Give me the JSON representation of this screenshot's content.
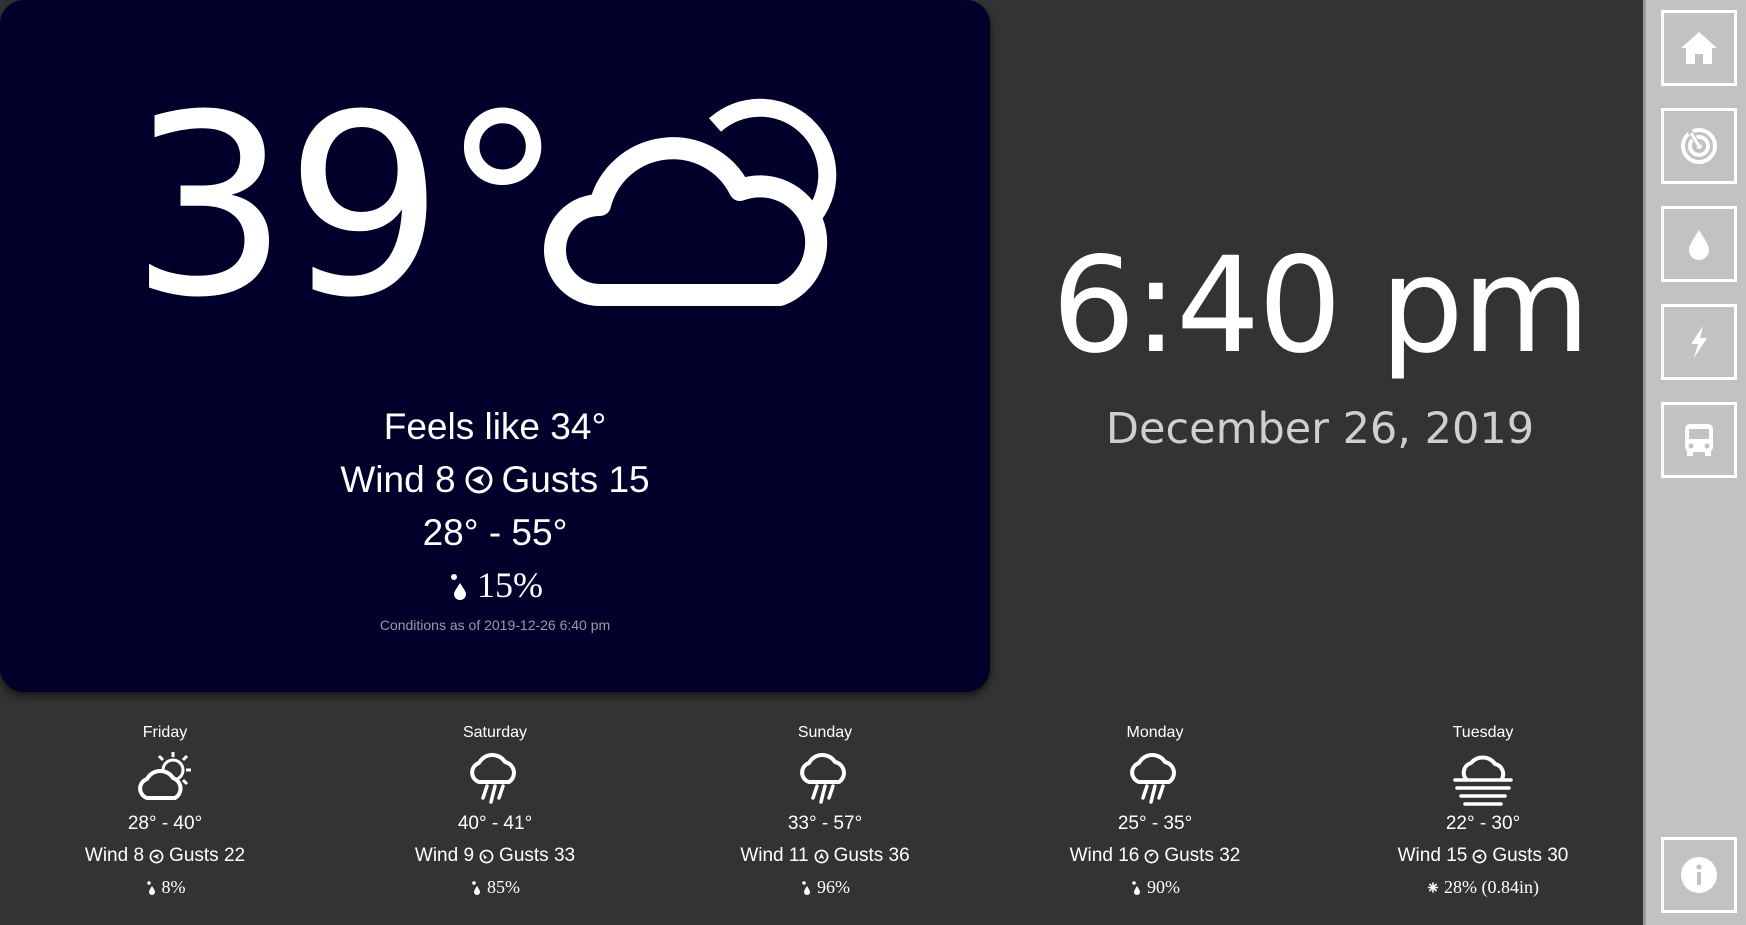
{
  "current": {
    "temperature": "39°",
    "condition_icon": "cloud-moon-icon",
    "feels_like": "Feels like 34°",
    "wind_label": "Wind 8",
    "gusts_label": "Gusts 15",
    "range": "28° - 55°",
    "precip": "15%",
    "as_of": "Conditions as of 2019-12-26 6:40 pm"
  },
  "clock": {
    "time": "6:40 pm",
    "date": "December 26, 2019"
  },
  "sidebar": {
    "items": [
      {
        "name": "home",
        "icon": "home-icon"
      },
      {
        "name": "radar",
        "icon": "radar-icon"
      },
      {
        "name": "water",
        "icon": "drop-icon"
      },
      {
        "name": "power",
        "icon": "lightning-icon"
      },
      {
        "name": "transit",
        "icon": "bus-icon"
      },
      {
        "name": "info",
        "icon": "info-icon"
      }
    ]
  },
  "forecast": [
    {
      "day": "Friday",
      "icon": "partly-cloudy-sun-icon",
      "range": "28° - 40°",
      "wind": "Wind 8",
      "gusts": "Gusts 22",
      "precip": "8%"
    },
    {
      "day": "Saturday",
      "icon": "rain-icon",
      "range": "40° - 41°",
      "wind": "Wind 9",
      "gusts": "Gusts 33",
      "precip": "85%"
    },
    {
      "day": "Sunday",
      "icon": "rain-icon",
      "range": "33° - 57°",
      "wind": "Wind 11",
      "gusts": "Gusts 36",
      "precip": "96%"
    },
    {
      "day": "Monday",
      "icon": "rain-icon",
      "range": "25° - 35°",
      "wind": "Wind 16",
      "gusts": "Gusts 32",
      "precip": "90%"
    },
    {
      "day": "Tuesday",
      "icon": "fog-icon",
      "range": "22° - 30°",
      "wind": "Wind 15",
      "gusts": "Gusts 30",
      "precip": "28% (0.84in)"
    }
  ]
}
